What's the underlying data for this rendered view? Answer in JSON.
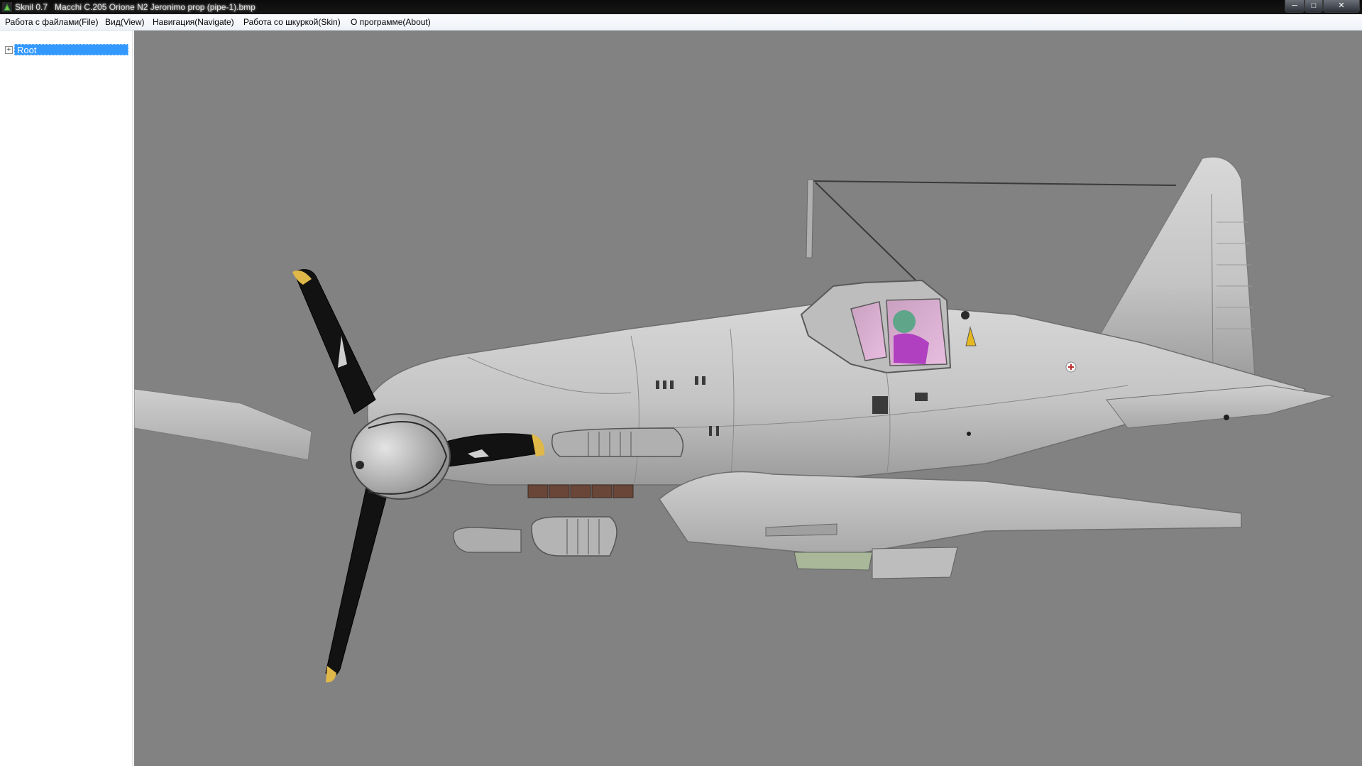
{
  "window": {
    "title": "Sknil 0.7   Macchi C.205 Orione N2 Jeronimo prop (pipe-1).bmp",
    "icon": "app-icon",
    "controls": [
      "minimize-icon",
      "maximize-icon",
      "close-icon"
    ]
  },
  "menu": {
    "items": [
      "Работа с файлами(File)",
      "Вид(View)",
      "Навигация(Navigate)",
      "Работа со шкуркой(Skin)",
      "О программе(About)"
    ]
  },
  "tree": {
    "expander": "+",
    "root_label": "Root"
  },
  "viewport": {
    "background": "#828282",
    "model": "Macchi C.205 aircraft 3D model",
    "propeller_tip_color": "#e0b84a",
    "fuselage_color": "#c8c8c8"
  }
}
